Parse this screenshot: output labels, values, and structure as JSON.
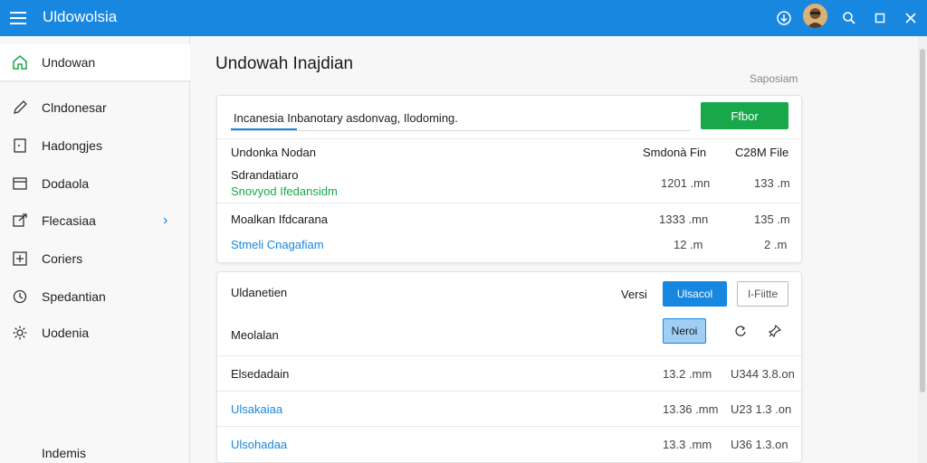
{
  "app": {
    "title": "Uldowolsia"
  },
  "colors": {
    "accent": "#1787e0",
    "green": "#18a84a"
  },
  "titlebar_icons": [
    "download-circle-icon",
    "search-icon",
    "maximize-icon",
    "close-icon"
  ],
  "sidebar": {
    "items": [
      {
        "label": "Undowan",
        "icon": "home-icon"
      },
      {
        "label": "Clndonesar",
        "icon": "pencil-icon"
      },
      {
        "label": "Hadongjes",
        "icon": "bookmark-icon"
      },
      {
        "label": "Dodaola",
        "icon": "window-icon"
      },
      {
        "label": "Flecasiaa",
        "icon": "share-icon"
      },
      {
        "label": "Coriers",
        "icon": "plus-box-icon"
      },
      {
        "label": "Spedantian",
        "icon": "clock-icon"
      },
      {
        "label": "Uodenia",
        "icon": "gear-icon"
      },
      {
        "label": "Indemis",
        "icon": "blank-icon"
      }
    ]
  },
  "main": {
    "title": "Undowah Inajdian",
    "subtitle": "Saposiam",
    "search": {
      "value": "Incanesia Inbanotary asdonvag, Ilodoming."
    },
    "primary_button": "Ffbor",
    "table": {
      "headers": {
        "name": "Undonka Nodan",
        "col1": "Smdonà Fin",
        "col2": "C28M File"
      },
      "rows": [
        {
          "line1": "Sdrandatiaro",
          "line2": "Snovyod Ifedansidm",
          "col1": "1201 .mn",
          "col2": "133 .m"
        },
        {
          "line1": "Moalkan Ifdcarana",
          "col1": "1333 .mn",
          "col2": "135 .m"
        },
        {
          "line1": "Stmeli Cnagafiam",
          "col1": "12 .m",
          "col2": "2 .m"
        }
      ]
    },
    "panel": {
      "title": "Uldanetien",
      "versi_label": "Versi",
      "blue_button": "Ulsacol",
      "outline_button": "I-Fiitte",
      "row2_label": "Meolalan",
      "light_button": "Neroi",
      "rows": [
        {
          "name": "Elsedadain",
          "col1": "13.2 .mm",
          "col2": "U344 3.8.on"
        },
        {
          "name": "Ulsakaiaa",
          "col1": "13.36 .mm",
          "col2": "U23 1.3 .on"
        },
        {
          "name": "Ulsohadaa",
          "col1": "13.3 .mm",
          "col2": "U36 1.3.on"
        }
      ]
    }
  }
}
